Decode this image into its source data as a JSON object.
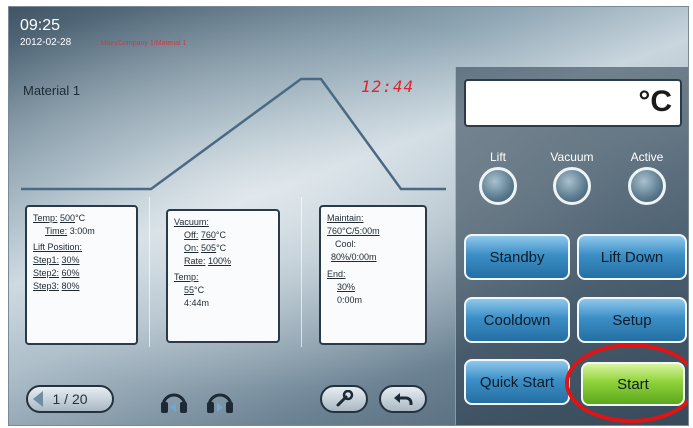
{
  "header": {
    "time": "09:25",
    "date": "2012-02-28",
    "breadcrumb": ":: Main/Company 1/Material 1"
  },
  "program": {
    "material_name": "Material 1",
    "timer": "12:44"
  },
  "info_boxes": {
    "temp_time": {
      "temp_label": "Temp:",
      "temp_value": "500",
      "temp_unit": "°C",
      "time_label": "Time:",
      "time_value": "3:00m",
      "lift_label": "Lift Position:",
      "step1_label": "Step1:",
      "step1_value": "30%",
      "step2_label": "Step2:",
      "step2_value": "60%",
      "step3_label": "Step3:",
      "step3_value": "80%"
    },
    "vacuum": {
      "vacuum_label": "Vacuum:",
      "off_label": "Off:",
      "off_value": "760",
      "on_label": "On:",
      "on_value": "505",
      "rate_label": "Rate:",
      "rate_value": "100%",
      "temp_label": "Temp:",
      "temp_value": "55",
      "unit": "°C",
      "time_value": "4:44m"
    },
    "maintain": {
      "maintain_label": "Maintain:",
      "maintain_value": "760°C/5:00m",
      "cool_label": "Cool:",
      "cool_value": "80%/0:00m",
      "end_label": "End:",
      "end_value": "30%",
      "end_time": "0:00m"
    }
  },
  "bottom_bar": {
    "page_indicator": "1 / 20"
  },
  "right_panel": {
    "temp_unit": "°C",
    "indicators": [
      "Lift",
      "Vacuum",
      "Active"
    ],
    "buttons": {
      "standby": "Standby",
      "lift_down": "Lift Down",
      "cooldown": "Cooldown",
      "setup": "Setup",
      "quick_start": "Quick Start",
      "start": "Start"
    }
  },
  "colors": {
    "timer": "#e0232e",
    "button_blue": "#3c8fc6",
    "start_green": "#8fd23a",
    "highlight_red": "#e01414"
  }
}
